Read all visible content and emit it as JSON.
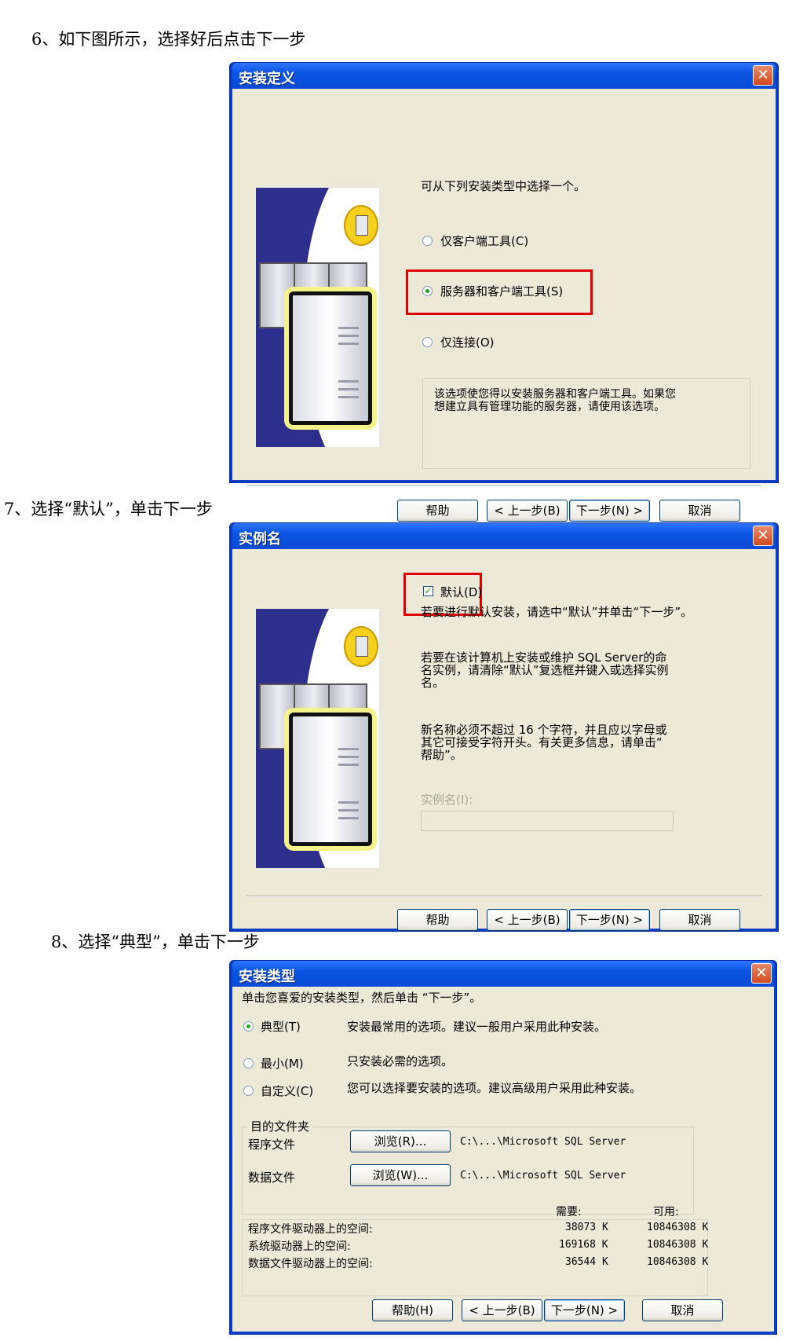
{
  "step6": {
    "heading": "6、如下图所示，选择好后点击下一步",
    "title": "安装定义",
    "close": "✕",
    "prompt": "可从下列安装类型中选择一个。",
    "options": [
      "仅客户端工具(C)",
      "服务器和客户端工具(S)",
      "仅连接(O)"
    ],
    "selected_index": 1,
    "description": "该选项使您得以安装服务器和客户端工具。如果您\n想建立具有管理功能的服务器，请使用该选项。",
    "buttons": {
      "help": "帮助",
      "back": "< 上一步(B)",
      "next": "下一步(N) >",
      "cancel": "取消"
    }
  },
  "step7": {
    "heading": "7、选择“默认”，单击下一步",
    "title": "实例名",
    "close": "✕",
    "default_checkbox": "默认(D)",
    "default_checked": true,
    "para1": "若要进行默认安装，请选中“默认”并单击“下一步”。",
    "para2": "若要在该计算机上安装或维护 SQL Server的命\n名实例，请清除“默认”复选框并键入或选择实例\n名。",
    "para3": "新名称必须不超过 16 个字符，并且应以字母或\n其它可接受字符开头。有关更多信息，请单击“\n帮助”。",
    "instance_label": "实例名(I):",
    "instance_value": "",
    "buttons": {
      "help": "帮助",
      "back": "< 上一步(B)",
      "next": "下一步(N) >",
      "cancel": "取消"
    }
  },
  "step8": {
    "heading": "8、选择“典型”，单击下一步",
    "title": "安装类型",
    "close": "✕",
    "prompt": "单击您喜爱的安装类型，然后单击 “下一步”。",
    "types": [
      {
        "label": "典型(T)",
        "desc": "安装最常用的选项。建议一般用户采用此种安装。",
        "selected": true
      },
      {
        "label": "最小(M)",
        "desc": "只安装必需的选项。",
        "selected": false
      },
      {
        "label": "自定义(C)",
        "desc": "您可以选择要安装的选项。建议高级用户采用此种安装。",
        "selected": false
      }
    ],
    "dest_group": "目的文件夹",
    "program_files": {
      "label": "程序文件",
      "browse": "浏览(R)...",
      "path": "C:\\...\\Microsoft SQL Server"
    },
    "data_files": {
      "label": "数据文件",
      "browse": "浏览(W)...",
      "path": "C:\\...\\Microsoft SQL Server"
    },
    "space": {
      "required_header": "需要:",
      "available_header": "可用:",
      "rows": [
        {
          "label": "程序文件驱动器上的空间:",
          "required": "38073 K",
          "available": "10846308 K"
        },
        {
          "label": "系统驱动器上的空间:",
          "required": "169168 K",
          "available": "10846308 K"
        },
        {
          "label": "数据文件驱动器上的空间:",
          "required": "36544 K",
          "available": "10846308 K"
        }
      ]
    },
    "buttons": {
      "help": "帮助(H)",
      "back": "< 上一步(B)",
      "next": "下一步(N) >",
      "cancel": "取消"
    }
  }
}
